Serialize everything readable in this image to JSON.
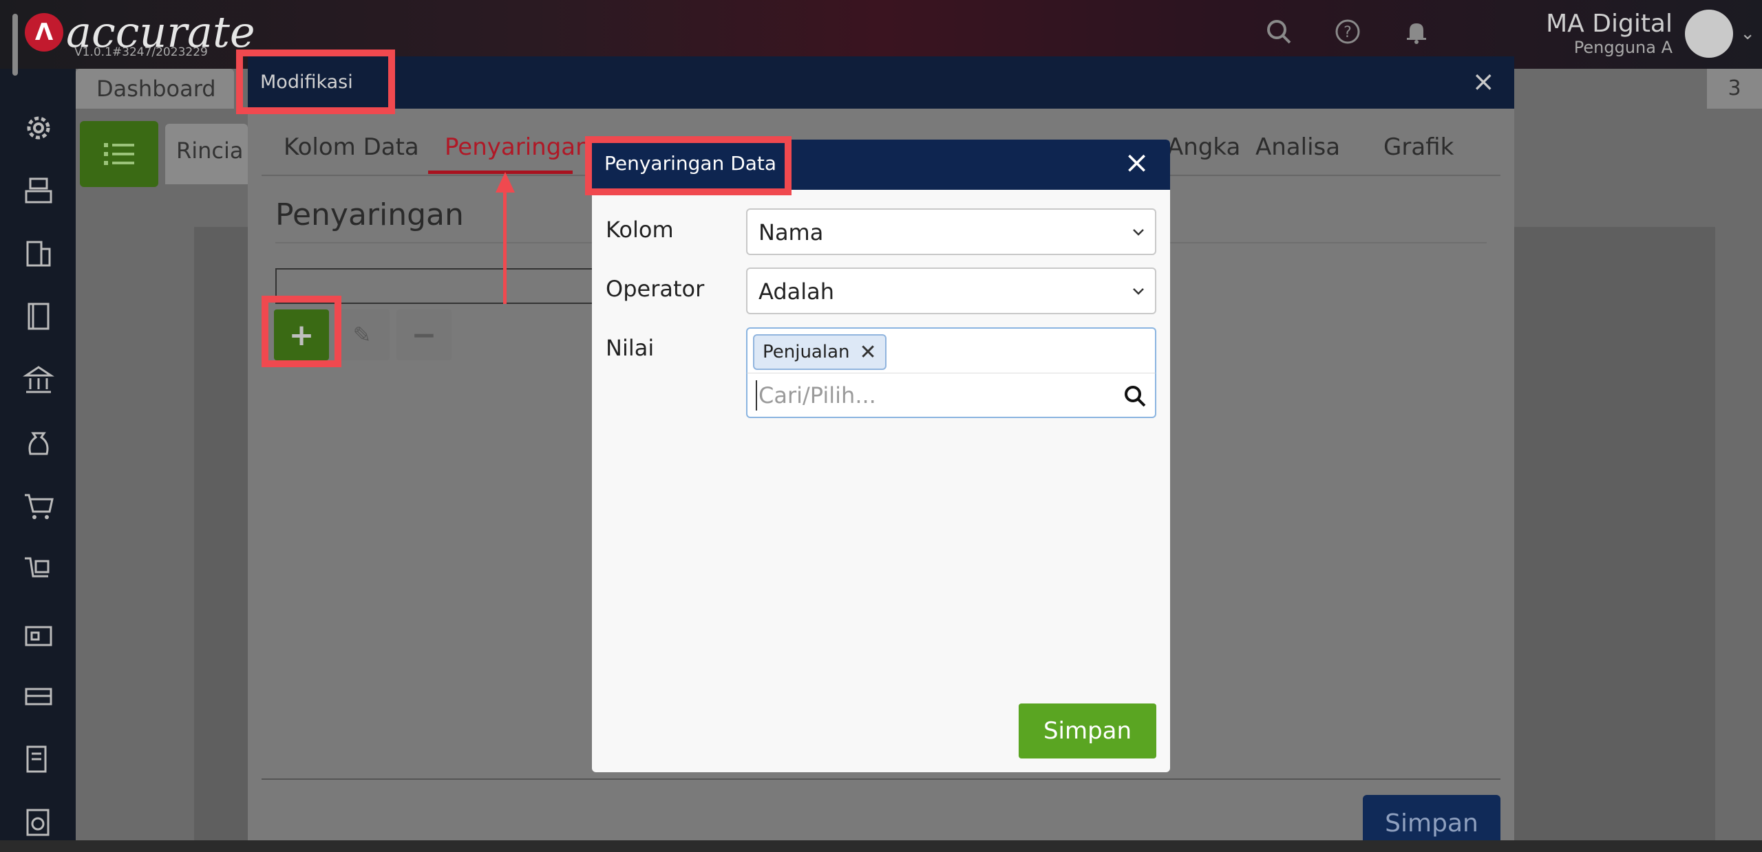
{
  "app": {
    "brand": "accurate",
    "logo_letter": "Λ",
    "version": "V1.0.1#3247/2023229",
    "company": "MA Digital",
    "user_role": "Pengguna A"
  },
  "background": {
    "dashboard_tab": "Dashboard",
    "rincian_tab": "Rincia",
    "right_tab": "3"
  },
  "modifikasi": {
    "title": "Modifikasi",
    "close_glyph": "×",
    "tabs": [
      {
        "label": "Kolom Data"
      },
      {
        "label": "Penyaringan"
      },
      {
        "label": "Angka"
      },
      {
        "label": "Analisa"
      },
      {
        "label": "Grafik"
      }
    ],
    "section_title": "Penyaringan",
    "add_glyph": "+",
    "edit_glyph": "✎",
    "remove_glyph": "−",
    "save_label": "Simpan"
  },
  "dialog": {
    "title": "Penyaringan Data",
    "close_glyph": "×",
    "kolom_label": "Kolom",
    "kolom_value": "Nama",
    "operator_label": "Operator",
    "operator_value": "Adalah",
    "nilai_label": "Nilai",
    "nilai_tags": [
      "Penjualan"
    ],
    "tag_remove_glyph": "✕",
    "search_placeholder": "Cari/Pilih...",
    "save_label": "Simpan"
  },
  "colors": {
    "accent_red": "#f0494f",
    "header_navy": "#0e2550",
    "save_green": "#5aa522",
    "active_tab": "#b01826"
  }
}
